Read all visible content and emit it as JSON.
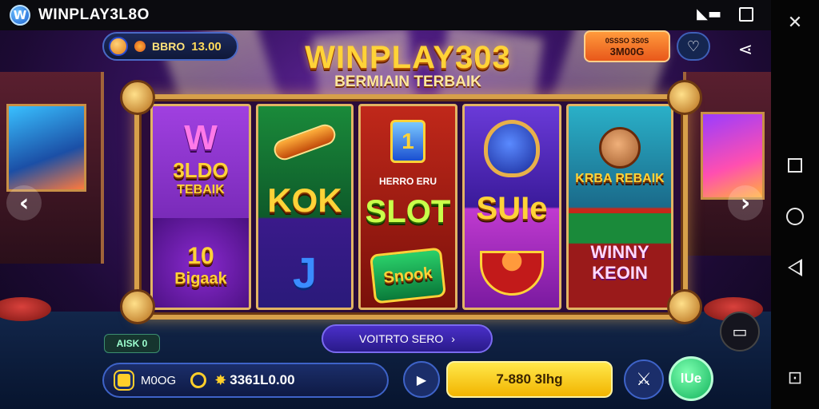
{
  "status_bar": {
    "brand_logo_letter": "W",
    "brand_title": "WINPLAY3L8O",
    "icons": [
      "video-icon",
      "square-icon"
    ]
  },
  "nav_bar": {
    "icons": [
      "close-icon",
      "recents-icon",
      "home-icon",
      "back-icon",
      "screenshot-icon"
    ],
    "close_glyph": "✕",
    "screenshot_glyph": "⊡"
  },
  "header": {
    "coin_pill_label": "BBRO",
    "coin_pill_value": "13.00",
    "promo_line1": "0SSSO 3S0S",
    "promo_line2": "3M00G",
    "chat_glyph": "♡",
    "share_glyph": "⋖"
  },
  "title": {
    "main": "WINPLAY303",
    "sub": "BERMIAIN TERBAIK"
  },
  "reels": [
    {
      "top": "W",
      "top_sub": "3LDO",
      "top_sub2": "TEBAIK",
      "bottom": "10",
      "bottom_sub": "Bigaak"
    },
    {
      "top": "KOK",
      "bottom": "J"
    },
    {
      "top_small": "HERRO ERU",
      "top": "SLOT",
      "bottom": "Snook"
    },
    {
      "top": "SUIe"
    },
    {
      "top": "KRBA REBAIK",
      "bottom": "WINNY KEOIN"
    }
  ],
  "arrows": {
    "left": "‹",
    "right": "›"
  },
  "bottom": {
    "small_badge": "AISK 0",
    "mid_button": "VOITRTO SERO",
    "mid_arrow": "›",
    "balance_label": "M0OG",
    "balance_value": "3361L0.00",
    "bet_button": "7-880 3lhg",
    "spin_button": "lUe",
    "play_glyph": "▶",
    "tool_glyph": "⚔",
    "side_glyph": "▭"
  },
  "colors": {
    "accent_gold": "#ffd338",
    "spin_green": "#12b35c",
    "bet_yellow": "#f2b400"
  }
}
